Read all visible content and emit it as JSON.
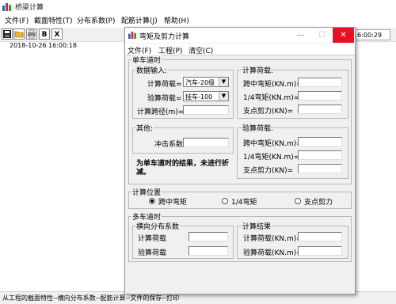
{
  "app": {
    "title": "桥梁计算",
    "menu": [
      "文件(F)",
      "截面特性(T)",
      "分布系数(P)",
      "配筋计算(J)",
      "帮助(H)"
    ],
    "toolbar_text_buttons": [
      "B",
      "X"
    ],
    "datetime_left": "2018-10-26  16:00:18",
    "datetime_right": "16:00:29",
    "status": "从工程的截面特性--横向分布系数--配筋计算--文件的保存--打印"
  },
  "dialog": {
    "title": "弯矩及剪力计算",
    "controls": {
      "minimize": "—",
      "maximize": "☐",
      "close": "✕"
    },
    "menu": [
      "文件(F)",
      "工程(P)",
      "清空(C)"
    ],
    "single_lane": {
      "title": "单车道时",
      "data_input": {
        "title": "数据输入:",
        "calc_load_label": "计算荷载=",
        "calc_load_value": "汽车-20级",
        "check_load_label": "验算荷载=",
        "check_load_value": "挂车-100",
        "span_label": "计算跨径(m)="
      },
      "calc_load": {
        "title": "计算荷载:",
        "mid_moment": "跨中弯矩(KN.m)=",
        "quarter_moment": "1/4弯矩(KN.m)=",
        "support_shear": "支点剪力(KN)="
      },
      "other": {
        "title": "其他:",
        "impact_label": "冲击系数="
      },
      "note": "为单车道时的结果，未进行折减。",
      "check_load": {
        "title": "验算荷载:",
        "mid_moment": "跨中弯矩(KN.m)=",
        "quarter_moment": "1/4弯矩(KN.m)=",
        "support_shear": "支点剪力(KN)="
      }
    },
    "calc_position": {
      "title": "计算位置",
      "options": [
        "跨中弯矩",
        "1/4弯矩",
        "支点剪力"
      ],
      "selected": 0
    },
    "multi_lane": {
      "title": "多车道时",
      "dist_coef": {
        "title": "横向分布系数",
        "calc_load": "计算荷载",
        "check_load": "验算荷载"
      },
      "result": {
        "title": "计算结果",
        "calc_load": "计算荷载(KN.m)=",
        "check_load": "验算荷载(KN.m)="
      }
    }
  }
}
